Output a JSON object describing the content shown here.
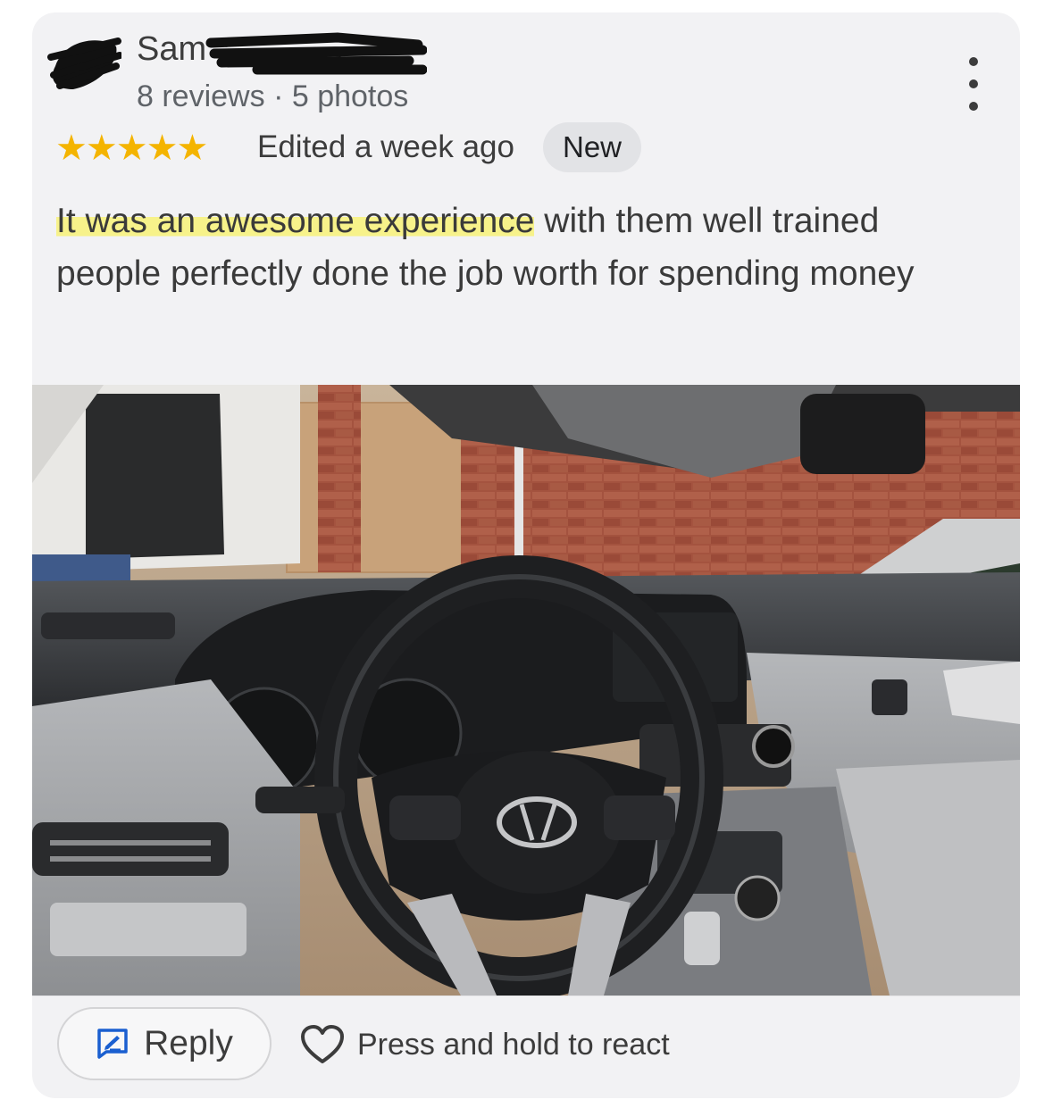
{
  "reviewer": {
    "name": "Sam",
    "reviews": "8 reviews",
    "separator": "·",
    "photos": "5 photos"
  },
  "rating": {
    "stars": 5,
    "max": 5,
    "star_color": "#f4b400"
  },
  "edited": "Edited a week ago",
  "badge": "New",
  "review": {
    "highlighted": "It was an awesome experience",
    "rest": " with them well trained people perfectly done the job worth for spending money",
    "highlight_color": "#f7f28a"
  },
  "photo": {
    "description_icon": "car-interior-photo",
    "steering_logo": "hyundai-logo"
  },
  "actions": {
    "reply_label": "Reply",
    "react_label": "Press and hold to react"
  },
  "icons": {
    "more": "more-vert-icon",
    "reply": "reply-icon",
    "heart": "heart-outline-icon"
  }
}
